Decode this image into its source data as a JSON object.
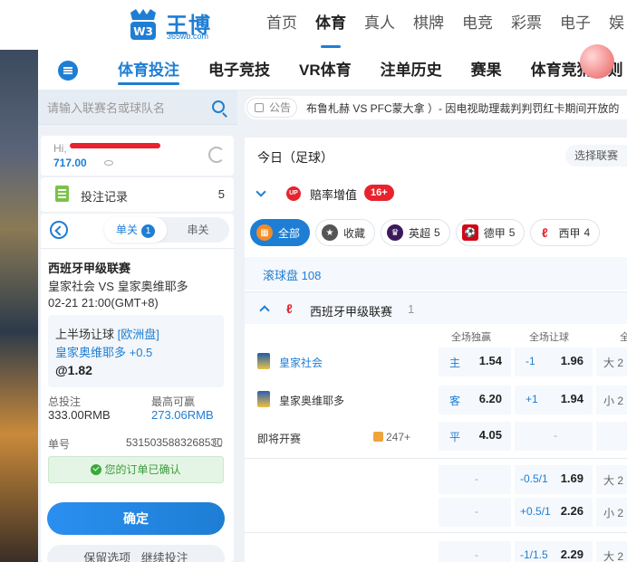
{
  "brand": {
    "name": "王博",
    "domain": "365wb.com",
    "color": "#1e7ed4"
  },
  "top_nav": [
    "首页",
    "体育",
    "真人",
    "棋牌",
    "电竞",
    "彩票",
    "电子",
    "娱"
  ],
  "top_nav_active": "体育",
  "sub_nav": [
    "体育投注",
    "电子竞技",
    "VR体育",
    "注单历史",
    "赛果",
    "体育竞猜规则"
  ],
  "sub_nav_active": "体育投注",
  "search": {
    "placeholder": "请输入联赛名或球队名"
  },
  "user": {
    "greeting": "Hi,",
    "balance": "717.00"
  },
  "bet_record": {
    "label": "投注记录",
    "count": "5"
  },
  "bet_type_tabs": {
    "single": "单关",
    "single_count": "1",
    "parlay": "串关"
  },
  "bet_slip": {
    "league": "西班牙甲级联赛",
    "teams": "皇家社会 VS 皇家奥维耶多",
    "time": "02-21 21:00(GMT+8)",
    "market": "上半场让球",
    "market_tag": "[欧洲盘]",
    "pick": "皇家奥维耶多 +0.5",
    "odds": "@1.82",
    "stake_label": "总投注",
    "stake_value": "333.00RMB",
    "win_label": "最高可赢",
    "win_value": "273.06RMB",
    "order_label": "单号",
    "order_value": "5315035883268530",
    "confirm_msg": "您的订单已确认",
    "confirm_button": "确定",
    "keep_button": "保留选项 继续投注"
  },
  "announcement": {
    "tag": "公告",
    "text": "布鲁札赫 VS PFC蒙大拿 ）- 因电视助理裁判判罚红卡期间开放的"
  },
  "market": {
    "today_title": "今日（足球）",
    "choose_league": "选择联赛",
    "boost_label": "赔率增值",
    "boost_badge": "16+",
    "filters": [
      {
        "label": "全部",
        "count": ""
      },
      {
        "label": "收藏",
        "count": ""
      },
      {
        "label": "英超",
        "count": "5"
      },
      {
        "label": "德甲",
        "count": "5"
      },
      {
        "label": "西甲",
        "count": "4"
      }
    ],
    "live_label": "滚球盘 108",
    "league_name": "西班牙甲级联赛",
    "league_count": "1",
    "col_heads": [
      "全场独赢",
      "全场让球",
      "全"
    ],
    "rows": [
      {
        "team": "皇家社会",
        "ml_label": "主",
        "ml_odds": "1.54",
        "hcp_label": "-1",
        "hcp_odds": "1.96",
        "total_label": "大 2"
      },
      {
        "team": "皇家奥维耶多",
        "ml_label": "客",
        "ml_odds": "6.20",
        "hcp_label": "+1",
        "hcp_odds": "1.94",
        "total_label": "小 2"
      },
      {
        "team": "即将开赛",
        "ml_label": "平",
        "ml_odds": "4.05",
        "hcp_label": "-",
        "hcp_odds": "",
        "total_label": "",
        "more": "247+"
      }
    ],
    "extra_rows": [
      {
        "hcp_label": "-0.5/1",
        "hcp_odds": "1.69",
        "total_label": "大 2"
      },
      {
        "hcp_label": "+0.5/1",
        "hcp_odds": "2.26",
        "total_label": "小 2"
      },
      {
        "hcp_label": "-1/1.5",
        "hcp_odds": "2.29",
        "total_label": "大 2"
      }
    ]
  }
}
